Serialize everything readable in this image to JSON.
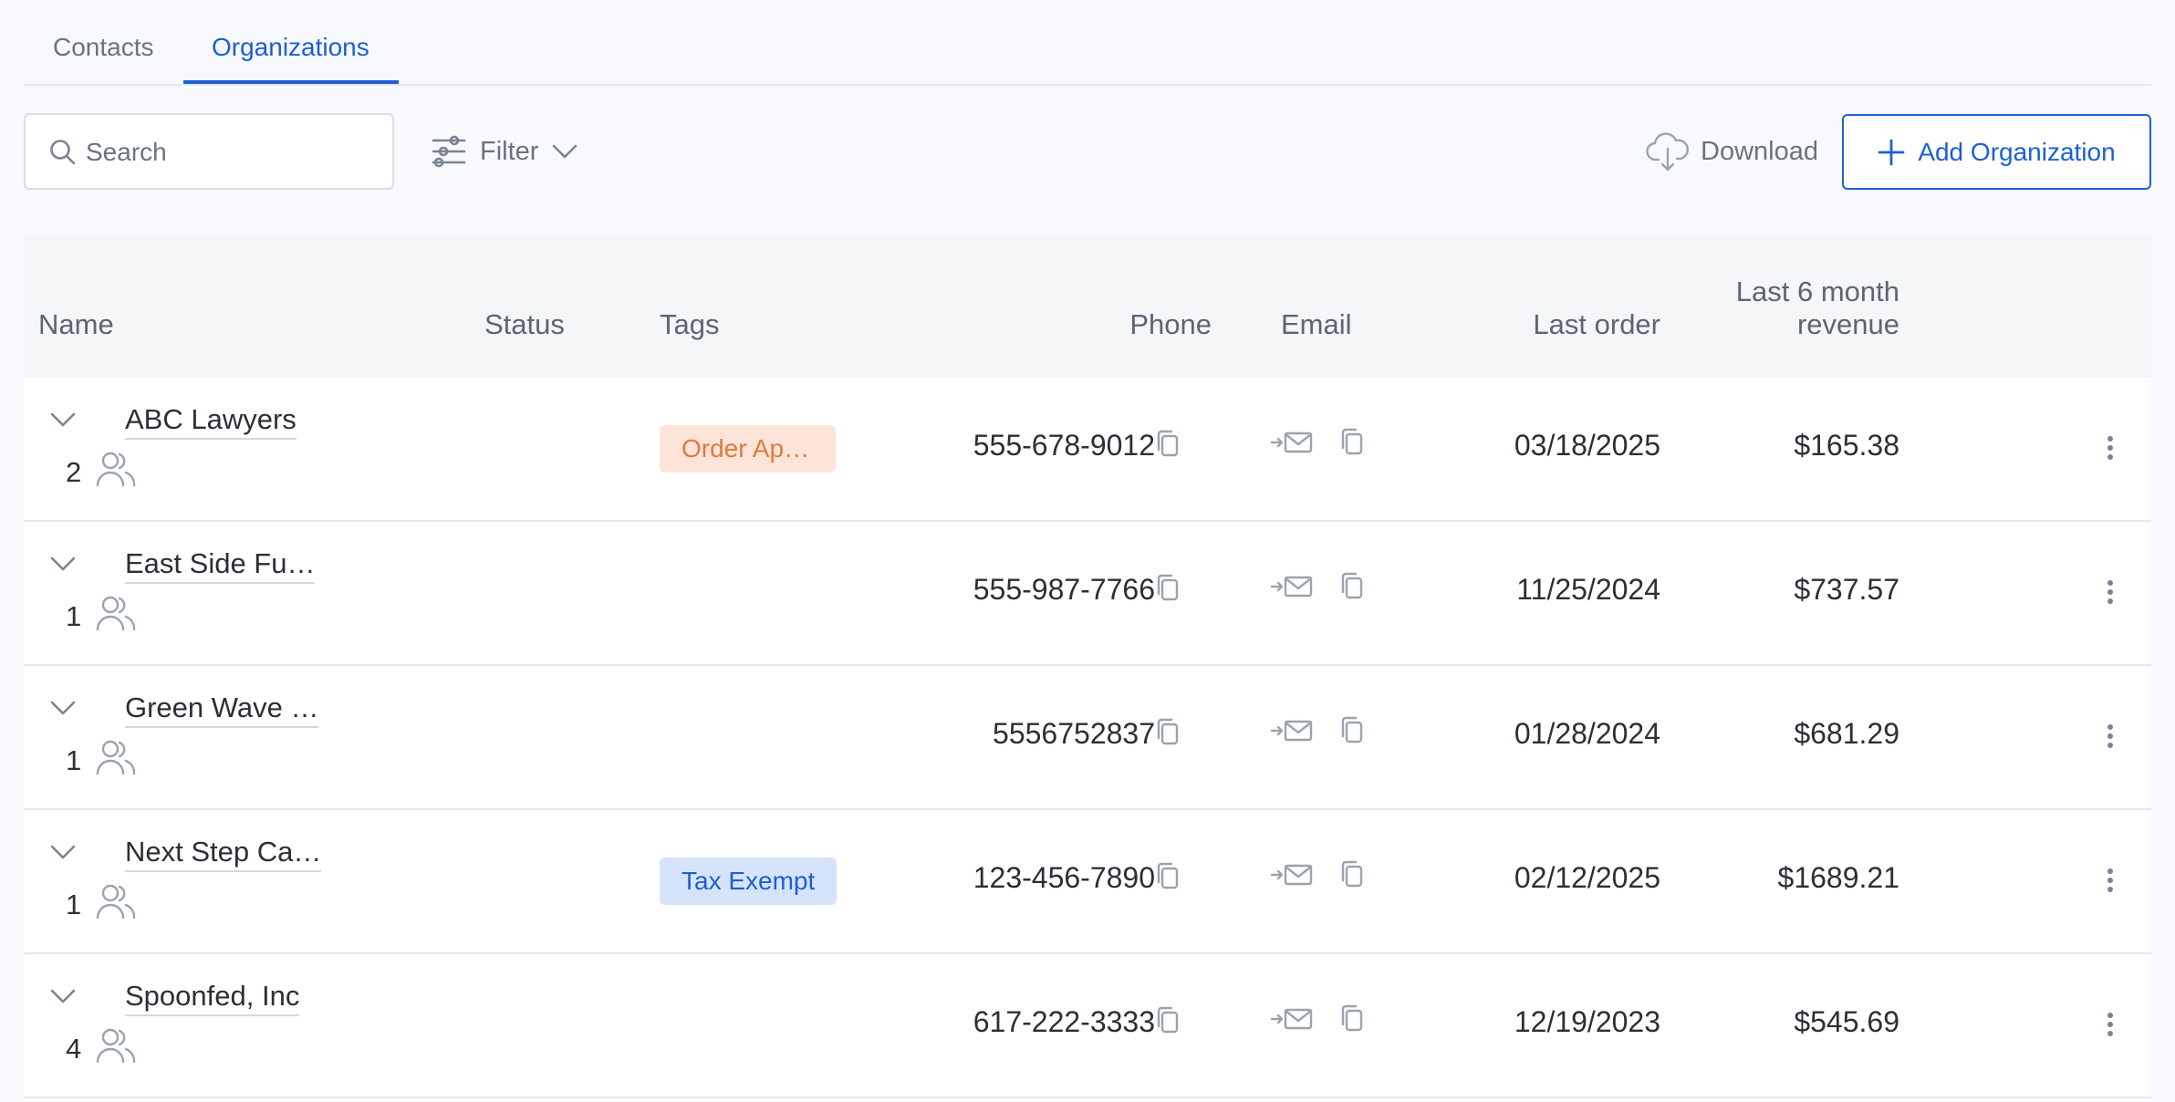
{
  "tabs": [
    {
      "label": "Contacts",
      "active": false
    },
    {
      "label": "Organizations",
      "active": true
    }
  ],
  "toolbar": {
    "search_placeholder": "Search",
    "filter_label": "Filter",
    "download_label": "Download",
    "add_label": "Add Organization"
  },
  "table": {
    "headers": {
      "name": "Name",
      "status": "Status",
      "tags": "Tags",
      "phone": "Phone",
      "email": "Email",
      "last_order": "Last order",
      "revenue_line1": "Last 6 month",
      "revenue_line2": "revenue"
    },
    "rows": [
      {
        "name": "ABC Lawyers",
        "count": "2",
        "tag": "Order Appro…",
        "tag_color": "orange",
        "phone": "555-678-9012",
        "last_order": "03/18/2025",
        "revenue": "$165.38"
      },
      {
        "name": "East Side Fu…",
        "count": "1",
        "tag": "",
        "tag_color": "",
        "phone": "555-987-7766",
        "last_order": "11/25/2024",
        "revenue": "$737.57"
      },
      {
        "name": "Green Wave …",
        "count": "1",
        "tag": "",
        "tag_color": "",
        "phone": "5556752837",
        "last_order": "01/28/2024",
        "revenue": "$681.29"
      },
      {
        "name": "Next Step Ca…",
        "count": "1",
        "tag": "Tax Exempt",
        "tag_color": "blue",
        "phone": "123-456-7890",
        "last_order": "02/12/2025",
        "revenue": "$1689.21"
      },
      {
        "name": "Spoonfed, Inc",
        "count": "4",
        "tag": "",
        "tag_color": "",
        "phone": "617-222-3333",
        "last_order": "12/19/2023",
        "revenue": "$545.69"
      }
    ]
  },
  "colors": {
    "accent": "#1d5fd6",
    "tag_orange_bg": "#fce4d8",
    "tag_orange_text": "#e07a3f",
    "tag_blue_bg": "#d6e4fb",
    "tag_blue_text": "#1d5fd6"
  },
  "icons": {
    "search": "search-icon",
    "filter": "sliders-icon",
    "filter_caret": "chevron-down-icon",
    "download": "cloud-download-icon",
    "add": "plus-icon",
    "expand": "chevron-down-icon",
    "contacts": "people-icon",
    "copy": "copy-icon",
    "send_email": "send-mail-icon",
    "more": "kebab-menu-icon"
  }
}
